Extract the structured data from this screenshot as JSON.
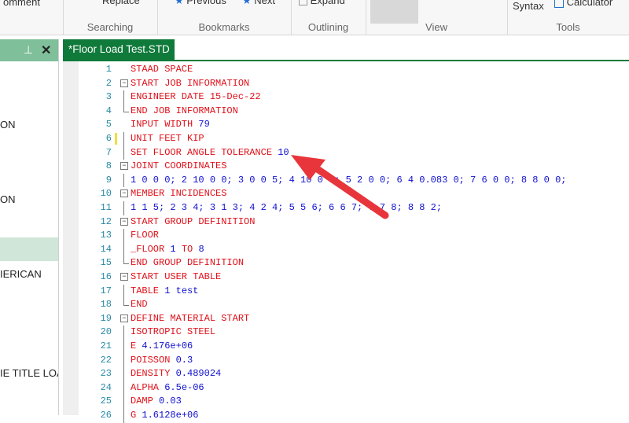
{
  "ribbon": {
    "top_texts": {
      "comment": "omment",
      "replace": "Replace",
      "previous": "Previous",
      "next": "Next",
      "expand": "Expand",
      "syntax": "Syntax",
      "calculator": "Calculator"
    },
    "groups": {
      "searching": "Searching",
      "bookmarks": "Bookmarks",
      "outlining": "Outlining",
      "view": "View",
      "tools": "Tools"
    }
  },
  "left_panel": {
    "items": [
      "ON",
      "ON",
      "IERICAN",
      "IE TITLE LOA"
    ]
  },
  "tab": {
    "label": "*Floor Load Test.STD"
  },
  "editor": {
    "lines": [
      {
        "n": "1",
        "t": [
          [
            "kw",
            "STAAD SPACE"
          ]
        ]
      },
      {
        "n": "2",
        "t": [
          [
            "kw",
            "START JOB INFORMATION"
          ]
        ]
      },
      {
        "n": "3",
        "t": [
          [
            "kw",
            "ENGINEER DATE 15-Dec-22"
          ]
        ]
      },
      {
        "n": "4",
        "t": [
          [
            "kw",
            "END JOB INFORMATION"
          ]
        ]
      },
      {
        "n": "5",
        "t": [
          [
            "kw",
            "INPUT WIDTH "
          ],
          [
            "num",
            "79"
          ]
        ]
      },
      {
        "n": "6",
        "t": [
          [
            "kw",
            "UNIT FEET KIP"
          ]
        ]
      },
      {
        "n": "7",
        "t": [
          [
            "kw",
            "SET FLOOR ANGLE TOLERANCE "
          ],
          [
            "num",
            "10"
          ]
        ]
      },
      {
        "n": "8",
        "t": [
          [
            "kw",
            "JOINT COORDINATES"
          ]
        ]
      },
      {
        "n": "9",
        "t": [
          [
            "num",
            "1 0 0 0; 2 10 0 0; 3 0 0 5; 4 10 0 5; 5 2 0 0; 6 4 0.083 0; 7 6 0 0; 8 8 0 0;"
          ]
        ]
      },
      {
        "n": "10",
        "t": [
          [
            "kw",
            "MEMBER INCIDENCES"
          ]
        ]
      },
      {
        "n": "11",
        "t": [
          [
            "num",
            "1 1 5; 2 3 4; 3 1 3; 4 2 4; 5 5 6; 6 6 7; 7 7 8; 8 8 2;"
          ]
        ]
      },
      {
        "n": "12",
        "t": [
          [
            "kw",
            "START GROUP DEFINITION"
          ]
        ]
      },
      {
        "n": "13",
        "t": [
          [
            "kw",
            "FLOOR"
          ]
        ]
      },
      {
        "n": "14",
        "t": [
          [
            "kw",
            "_FLOOR "
          ],
          [
            "num",
            "1"
          ],
          [
            "kw",
            " TO "
          ],
          [
            "num",
            "8"
          ]
        ]
      },
      {
        "n": "15",
        "t": [
          [
            "kw",
            "END GROUP DEFINITION"
          ]
        ]
      },
      {
        "n": "16",
        "t": [
          [
            "kw",
            "START USER TABLE"
          ]
        ]
      },
      {
        "n": "17",
        "t": [
          [
            "kw",
            "TABLE "
          ],
          [
            "num",
            "1 test"
          ]
        ]
      },
      {
        "n": "18",
        "t": [
          [
            "kw",
            "END"
          ]
        ]
      },
      {
        "n": "19",
        "t": [
          [
            "kw",
            "DEFINE MATERIAL START"
          ]
        ]
      },
      {
        "n": "20",
        "t": [
          [
            "kw",
            "ISOTROPIC STEEL"
          ]
        ]
      },
      {
        "n": "21",
        "t": [
          [
            "kw",
            "E "
          ],
          [
            "num",
            "4.176e+06"
          ]
        ]
      },
      {
        "n": "22",
        "t": [
          [
            "kw",
            "POISSON "
          ],
          [
            "num",
            "0.3"
          ]
        ]
      },
      {
        "n": "23",
        "t": [
          [
            "kw",
            "DENSITY "
          ],
          [
            "num",
            "0.489024"
          ]
        ]
      },
      {
        "n": "24",
        "t": [
          [
            "kw",
            "ALPHA "
          ],
          [
            "num",
            "6.5e-06"
          ]
        ]
      },
      {
        "n": "25",
        "t": [
          [
            "kw",
            "DAMP "
          ],
          [
            "num",
            "0.03"
          ]
        ]
      },
      {
        "n": "26",
        "t": [
          [
            "kw",
            "G "
          ],
          [
            "num",
            "1.6128e+06"
          ]
        ]
      }
    ]
  },
  "colors": {
    "accent_green": "#0f7a3a",
    "keyword_red": "#e0101a",
    "number_blue": "#1010d0",
    "annotation_arrow": "#e8353b"
  },
  "icons": [
    "star-icon",
    "calculator-icon",
    "pin-icon",
    "close-icon",
    "fold-toggle-icon"
  ]
}
